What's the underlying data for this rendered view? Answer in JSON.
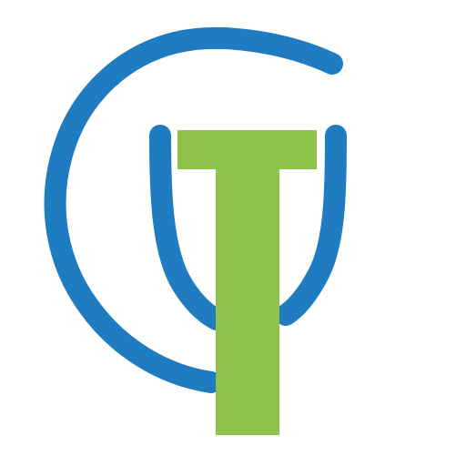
{
  "logo": {
    "colors": {
      "background": "#ffffff",
      "blue": "#1f7cc1",
      "green": "#8dc34a"
    },
    "icon": "psi-t-monogram"
  }
}
